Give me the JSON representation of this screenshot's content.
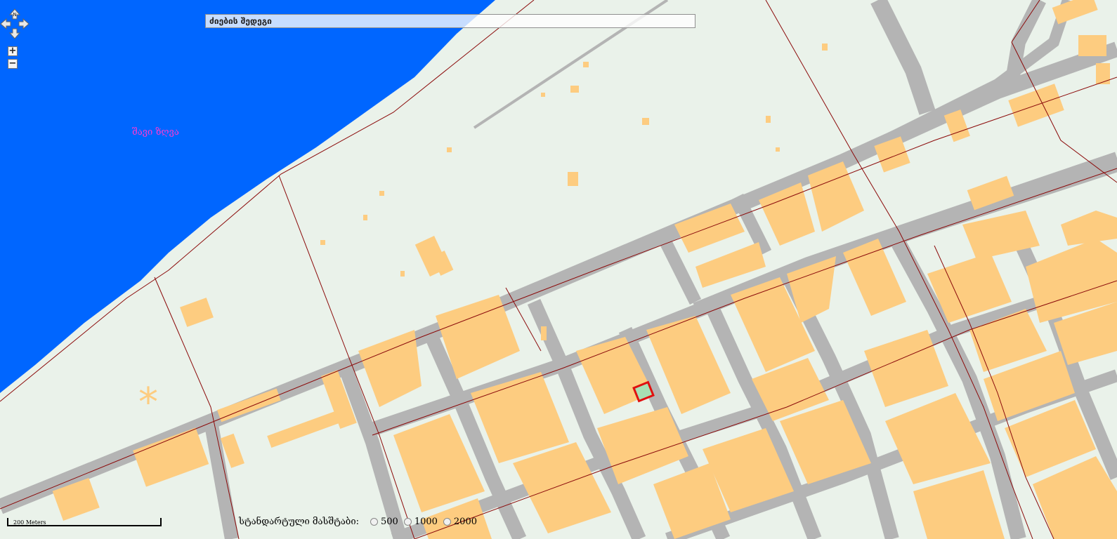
{
  "map": {
    "colors": {
      "water": "#0066ff",
      "land": "#eaf2ea",
      "road": "#b4b4b4",
      "building": "#fdcc80",
      "boundary": "#8b0a0a",
      "selection": "#e01010",
      "selection_fill": "#a7e0b4"
    },
    "water_label": "შავი ზღვა"
  },
  "controls": {
    "north_label": "N",
    "zoom_in": "+",
    "zoom_out": "−"
  },
  "search": {
    "value": "ძიების შედეგი"
  },
  "scalebar": {
    "label": "200 Meters"
  },
  "standard_scales": {
    "label": "სტანდარტული მასშტაბი:",
    "options": [
      "500",
      "1000",
      "2000"
    ]
  }
}
